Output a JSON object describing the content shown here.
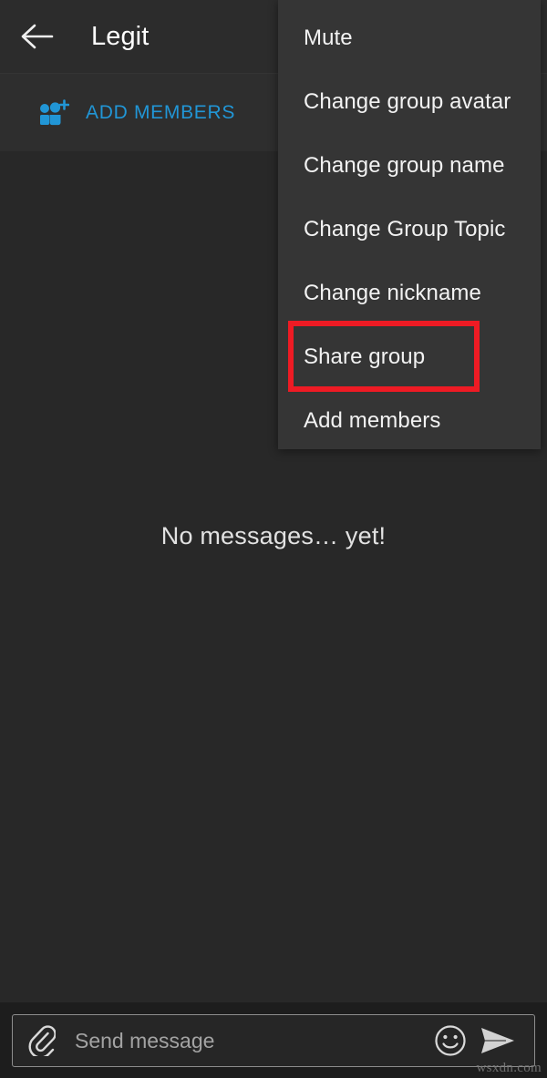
{
  "header": {
    "back_icon": "back-arrow-icon",
    "title": "Legit"
  },
  "add_members_bar": {
    "icon": "add-people-icon",
    "label": "ADD MEMBERS",
    "accent_color": "#2196d6"
  },
  "chat": {
    "empty_state_text": "No messages… yet!",
    "background_color": "#282828"
  },
  "menu": {
    "background_color": "#353535",
    "items": [
      {
        "label": "Mute"
      },
      {
        "label": "Change group avatar"
      },
      {
        "label": "Change group name"
      },
      {
        "label": "Change Group Topic"
      },
      {
        "label": "Change nickname"
      },
      {
        "label": "Share group"
      },
      {
        "label": "Add members"
      }
    ]
  },
  "highlight": {
    "target_label": "Share group",
    "color": "#ee1b24"
  },
  "input_bar": {
    "attach_icon": "paperclip-icon",
    "placeholder": "Send message",
    "value": "",
    "emoji_icon": "smiley-face-icon",
    "send_icon": "send-paper-plane-icon"
  },
  "watermark": {
    "text": "wsxdn.com"
  }
}
